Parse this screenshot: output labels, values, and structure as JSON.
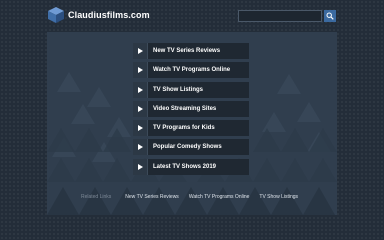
{
  "header": {
    "logo_text": "Claudiusfilms.com",
    "search": {
      "value": "",
      "placeholder": ""
    }
  },
  "main": {
    "links": [
      {
        "label": "New TV Series Reviews"
      },
      {
        "label": "Watch TV Programs Online"
      },
      {
        "label": "TV Show Listings"
      },
      {
        "label": "Video Streaming Sites"
      },
      {
        "label": "TV Programs for Kids"
      },
      {
        "label": "Popular Comedy Shows"
      },
      {
        "label": "Latest TV Shows 2019"
      }
    ]
  },
  "footer": {
    "related_title": "Related Links",
    "related_links": [
      "New TV Series Reviews",
      "Watch TV Programs Online",
      "TV Show Listings"
    ]
  },
  "icons": {
    "logo": "cube-logo-icon",
    "search": "search-icon",
    "arrow": "play-arrow-icon"
  },
  "colors": {
    "background": "#232d39",
    "panel": "#303e4e",
    "link_bg": "#1f2832",
    "search_button": "#3b6aa0",
    "accent_blue": "#4a78b5"
  }
}
